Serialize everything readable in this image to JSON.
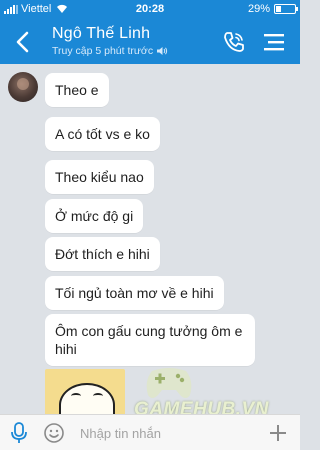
{
  "status_bar": {
    "carrier": "Viettel",
    "time": "20:28",
    "battery_text": "29%",
    "battery_level": 0.29
  },
  "header": {
    "contact_name": "Ngô Thế Linh",
    "status": "Truy cập 5 phút trước",
    "back_icon": "chevron-left-icon",
    "speaker_icon": "speaker-icon",
    "call_icon": "phone-icon",
    "menu_icon": "menu-icon"
  },
  "messages": [
    {
      "text": "Theo e"
    },
    {
      "text": "A có tốt vs e ko"
    },
    {
      "text": "Theo kiểu nao"
    },
    {
      "text": "Ở mức độ gi"
    },
    {
      "text": "Đớt thích e hihi"
    },
    {
      "text": "Tối ngủ toàn mơ về e hihi"
    },
    {
      "text": "Ôm con gấu cung tưởng ôm e hihi"
    }
  ],
  "watermark": {
    "brand": "GAMEHUB.VN"
  },
  "input_bar": {
    "placeholder": "Nhập tin nhắn",
    "mic_icon": "microphone-icon",
    "emoji_icon": "emoji-icon",
    "plus_icon": "plus-icon"
  },
  "colors": {
    "accent": "#1b88d6",
    "chat_background": "#dde1e6",
    "bubble": "#ffffff"
  }
}
